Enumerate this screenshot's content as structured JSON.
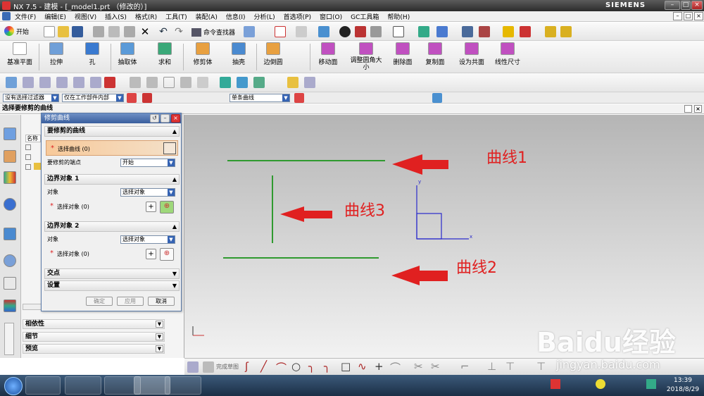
{
  "window": {
    "title": "NX 7.5 - 建模 - [_model1.prt （修改的）]",
    "brand": "SIEMENS"
  },
  "menu": [
    "文件(F)",
    "编辑(E)",
    "视图(V)",
    "插入(S)",
    "格式(R)",
    "工具(T)",
    "装配(A)",
    "信息(I)",
    "分析(L)",
    "首选项(P)",
    "窗口(O)",
    "GC工具箱",
    "帮助(H)"
  ],
  "toolbar": {
    "start_label": "开始",
    "command_finder": "命令查找器"
  },
  "feature_toolbar": [
    "基准平面",
    "拉伸",
    "孔",
    "抽取体",
    "求和",
    "修剪体",
    "抽壳",
    "边倒圆",
    "移动面",
    "调整圆角大小",
    "删除面",
    "复制面",
    "设为共面",
    "线性尺寸"
  ],
  "filter_bar": {
    "filter_value": "没有选择过滤器",
    "scope_value": "仅在工作部件内部",
    "curve_rule": "单条曲线"
  },
  "prompt": "选择要修剪的曲线",
  "nav": {
    "col_header": "名称"
  },
  "dialog": {
    "title": "修剪曲线",
    "sec1": "要修剪的曲线",
    "select_curve": "选择曲线 (0)",
    "endpoint_label": "要修剪的端点",
    "endpoint_value": "开始",
    "sec2": "边界对象 1",
    "object_label": "对象",
    "object_value": "选择对象",
    "select_object": "选择对象 (0)",
    "sec3": "边界对象 2",
    "object2_label": "对象",
    "object2_value": "选择对象",
    "select_object2": "选择对象 (0)",
    "sec4": "交点",
    "sec5": "设置",
    "ok": "确定",
    "apply": "应用",
    "cancel": "取消"
  },
  "panels": [
    "相依性",
    "细节",
    "预览"
  ],
  "canvas": {
    "label1": "曲线1",
    "label2": "曲线2",
    "label3": "曲线3",
    "axis_x": "x",
    "axis_y": "y"
  },
  "sketch_toolbar": {
    "finish_sketch": "完成草图"
  },
  "taskbar": {
    "time": "13:39",
    "date": "2018/8/29"
  },
  "watermark": {
    "logo": "Baidu经验",
    "url": "jingyan.baidu.com"
  },
  "colors": {
    "curve_green": "#2f9a2f",
    "annotation_red": "#e02020",
    "csys_blue": "#2a2acc"
  }
}
